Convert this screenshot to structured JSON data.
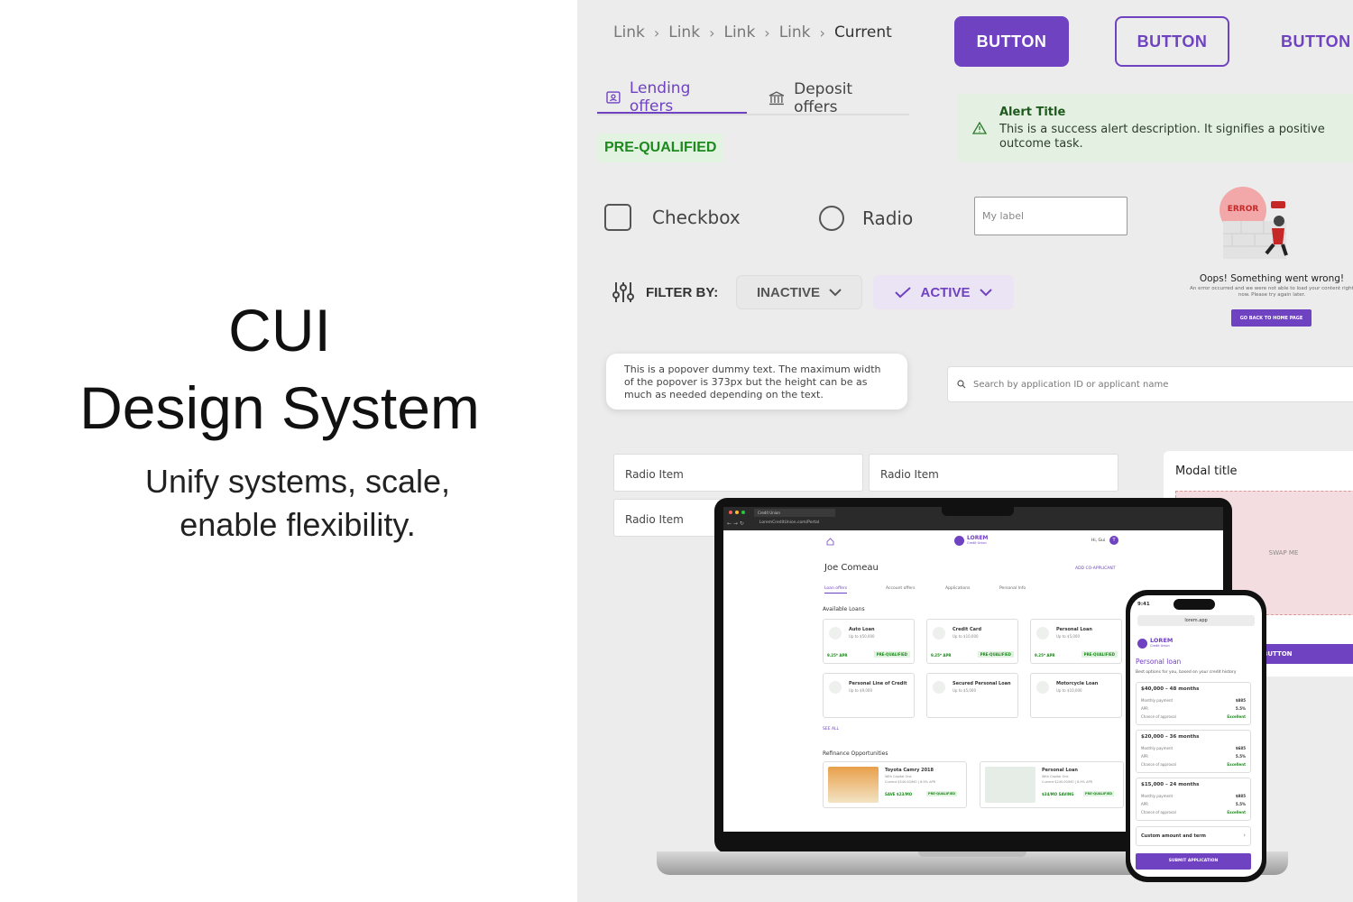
{
  "hero": {
    "title_line1": "CUI",
    "title_line2": "Design System",
    "subtitle_line1": "Unify systems, scale,",
    "subtitle_line2": "enable flexibility."
  },
  "breadcrumb": {
    "items": [
      "Link",
      "Link",
      "Link",
      "Link"
    ],
    "current": "Current"
  },
  "buttons": {
    "filled": "BUTTON",
    "outline": "BUTTON",
    "text": "BUTTON"
  },
  "tabs": {
    "lending": "Lending offers",
    "deposit": "Deposit offers"
  },
  "badge": "PRE-QUALIFIED",
  "alert": {
    "title": "Alert Title",
    "description": "This is a success alert description. It signifies a positive outcome task."
  },
  "checkbox_label": "Checkbox",
  "radio_label": "Radio",
  "input": {
    "placeholder": "My label"
  },
  "error": {
    "badge": "ERROR",
    "title": "Oops! Something went wrong!",
    "desc": "An error occurred and we were not able to load your content right now. Please try again later.",
    "button": "GO BACK TO HOME PAGE"
  },
  "filter": {
    "label": "FILTER BY:",
    "inactive": "INACTIVE",
    "active": "ACTIVE"
  },
  "popover": "This is a popover dummy text. The maximum width of the popover is 373px but the height can be as much as needed depending on the text.",
  "search_placeholder": "Search by application ID or applicant name",
  "radio_items": [
    "Radio Item",
    "Radio Item",
    "Radio Item"
  ],
  "modal": {
    "title": "Modal title",
    "swap": "SWAP ME",
    "button": "BUTTON"
  },
  "laptop": {
    "tab_title": "Credit Union",
    "url": "LoremCreditUnion.com/Portal",
    "brand": "LOREM",
    "brand_sub": "Credit Union",
    "greeting": "Hi, Gui",
    "avatar": "T",
    "user": "Joe Comeau",
    "add_coapplicant": "ADD CO-APPLICANT",
    "nav": [
      "Loan offers",
      "Account offers",
      "Applications",
      "Personal Info"
    ],
    "available_heading": "Available Loans",
    "loans": [
      {
        "name": "Auto Loan",
        "sub": "Up to $50,000",
        "apr": "9.25* APR",
        "badge": "PRE-QUALIFIED"
      },
      {
        "name": "Credit Card",
        "sub": "Up to $10,000",
        "apr": "9.25* APR",
        "badge": "PRE-QUALIFIED"
      },
      {
        "name": "Personal Loan",
        "sub": "Up to $5,000",
        "apr": "9.25* APR",
        "badge": "PRE-QUALIFIED"
      },
      {
        "name": "Personal Line of Credit",
        "sub": "Up to $9,000"
      },
      {
        "name": "Secured Personal Loan",
        "sub": "Up to $5,000"
      },
      {
        "name": "Motorcycle Loan",
        "sub": "Up to $10,000"
      }
    ],
    "see_all": "SEE ALL",
    "refi_heading": "Refinance Opportunities",
    "refi": [
      {
        "name": "Toyota Camry 2018",
        "sub": "With Capital One",
        "detail": "Current $540.00/MO | 6.9% APR",
        "save": "SAVE $23/MO",
        "badge": "PRE-QUALIFIED"
      },
      {
        "name": "Personal Loan",
        "sub": "With Capital One",
        "detail": "Current $240.00/MO | 8.9% APR",
        "save": "$34/MO SAVING",
        "badge": "PRE-QUALIFIED"
      }
    ]
  },
  "phone": {
    "time": "9:41",
    "url": "lorem.app",
    "brand": "LOREM",
    "brand_sub": "Credit Union",
    "heading": "Personal loan",
    "sub": "Best options for you, based on your credit history",
    "options": [
      {
        "title": "$40,000 – 48 months",
        "payment": "$885",
        "apr": "5.5%",
        "approval": "Excellent"
      },
      {
        "title": "$20,000 – 36 months",
        "payment": "$685",
        "apr": "5.5%",
        "approval": "Excellent"
      },
      {
        "title": "$15,000 – 24 months",
        "payment": "$885",
        "apr": "5.5%",
        "approval": "Excellent"
      }
    ],
    "row_labels": {
      "payment": "Monthly payment",
      "apr": "APR",
      "approval": "Chance of approval"
    },
    "custom": "Custom amount and term",
    "submit": "SUBMIT APPLICATION"
  },
  "colors": {
    "brand": "#6f42c1",
    "success": "#1c8a1c",
    "success_bg": "#e3f3e1",
    "panel_bg": "#ececec"
  }
}
